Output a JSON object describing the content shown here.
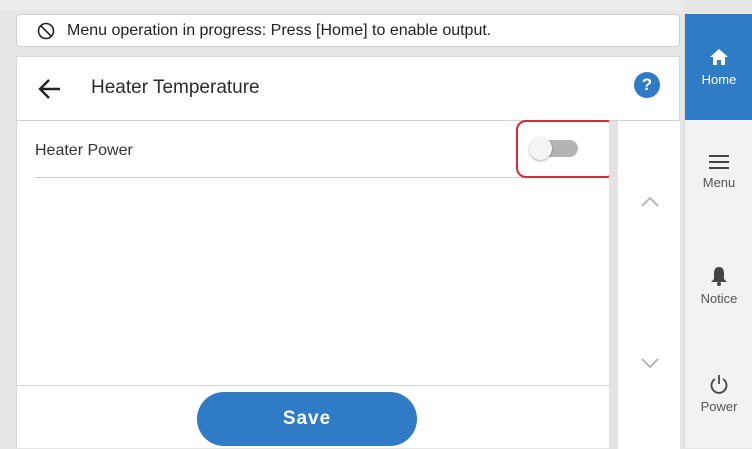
{
  "banner": {
    "icon": "no-entry-icon",
    "text": "Menu operation in progress: Press [Home] to enable output."
  },
  "header": {
    "back_icon": "back-arrow-icon",
    "title": "Heater Temperature",
    "help_label": "?"
  },
  "settings": [
    {
      "label": "Heater Power",
      "control": "toggle",
      "value": "off",
      "highlighted": true
    }
  ],
  "scroll": {
    "up_icon": "chevron-up-icon",
    "down_icon": "chevron-down-icon"
  },
  "footer": {
    "save_label": "Save"
  },
  "sidebar": {
    "items": [
      {
        "label": "Home",
        "icon": "home-icon",
        "active": true
      },
      {
        "label": "Menu",
        "icon": "hamburger-menu-icon",
        "active": false
      },
      {
        "label": "Notice",
        "icon": "bell-icon",
        "active": false
      },
      {
        "label": "Power",
        "icon": "power-icon",
        "active": false
      }
    ]
  },
  "colors": {
    "accent": "#2f7bc6",
    "highlight": "#d62b35",
    "toggle_off": "#b4b4b4"
  }
}
